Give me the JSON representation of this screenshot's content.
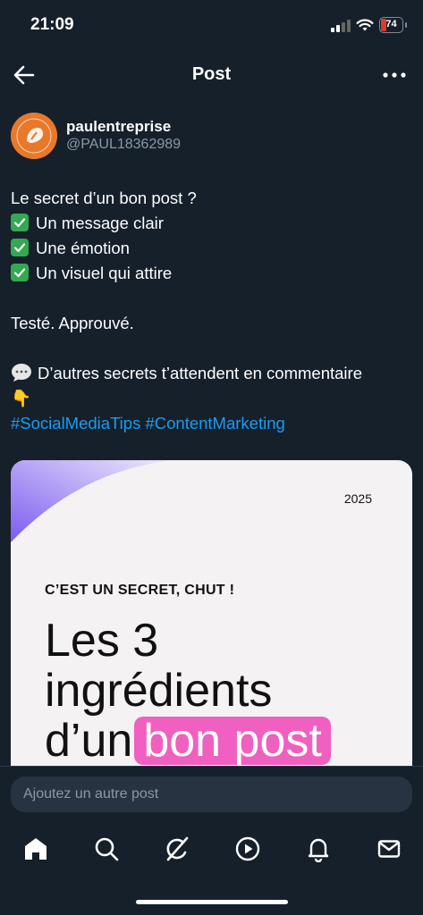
{
  "status_bar": {
    "time": "21:09",
    "battery": "74"
  },
  "header": {
    "title": "Post"
  },
  "author": {
    "display_name": "paulentreprise",
    "handle": "@PAUL18362989"
  },
  "post": {
    "intro": "Le secret d’un bon post ?",
    "checklist": [
      "Un message clair",
      "Une émotion",
      "Un visuel qui attire"
    ],
    "verdict": "Testé. Approuvé.",
    "cta": "D’autres secrets t’attendent en commentaire",
    "pointer": "👇",
    "hashtags": "#SocialMediaTips #ContentMarketing"
  },
  "image_card": {
    "year": "2025",
    "kicker": "C’EST UN SECRET, CHUT !",
    "headline_line1": "Les 3",
    "headline_line2": "ingrédients",
    "headline_line3_plain": "d’un",
    "headline_line3_highlight": "bon post"
  },
  "composer": {
    "placeholder": "Ajoutez un autre post"
  },
  "icons": {
    "nav": [
      "home-icon",
      "search-icon",
      "grok-icon",
      "video-icon",
      "bell-icon",
      "mail-icon"
    ]
  },
  "colors": {
    "background": "#15202b",
    "link": "#1d9bf0",
    "highlight": "#f060c0",
    "check": "#34a853"
  }
}
